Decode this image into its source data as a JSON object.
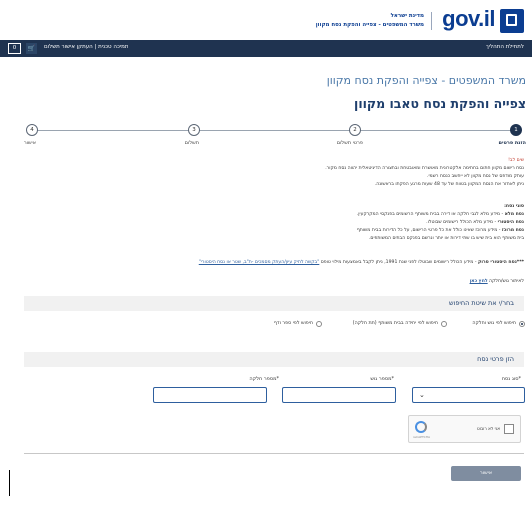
{
  "header": {
    "logo_text": "gov.il",
    "state_name": "מדינת ישראל",
    "ministry_line": "משרד המשפטים - צפייה והפקת נסח מקוון"
  },
  "topbar": {
    "back_link": "לתחילת התהליך",
    "help_link": "תמיכה טכנית | העתקן אישור תשלום",
    "cart_icon": "cart-icon",
    "cart_count": "0"
  },
  "page": {
    "subtitle": "משרד המשפטים - צפייה והפקת נסח מקוון",
    "title": "צפייה והפקת נסח טאבו מקוון"
  },
  "stepper": [
    {
      "number": "1",
      "label": "הזנת פרטים",
      "active": true
    },
    {
      "number": "2",
      "label": "פרטי תשלום",
      "active": false
    },
    {
      "number": "3",
      "label": "תשלום",
      "active": false
    },
    {
      "number": "4",
      "label": "אישור",
      "active": false
    }
  ],
  "info": {
    "attention": "שים לב!",
    "line1": "נסח רישום מקוון חתום בחתימה אלקטרונית מאושרת ומאובטחת ובתצורה הדיגיטאלית יהווה נסח מקור.",
    "line2": "עותק מודפס של נסח מקוון לא ייחשב כנסח רשמי.",
    "line3": "ניתן לאחזר את הנסח המקוון בטווח של עד 48 שעות מרגע הפקתו בראשונה.",
    "types_title": "סוגי נסח:",
    "type1_name": "נסח מלא",
    "type1_desc": " - מידע מלא לגבי חלקה או דירה בבית משותף הרשומים בפנקסי המקרקעין.",
    "type2_name": "נסח היסטורי",
    "type2_desc": " - מידע מלא הכולל רישומים שבוטלו.",
    "type3_name": "נסח מרוכז",
    "type3_desc": " - מידע מרוכז שאינו כולל את כל פרטי הרישום, על כל הדירות בבית משותף",
    "type3_cont": "בית משותף הוא בית שיש בו שתי דירות או יותר ונרשם בפנקס הבתים המשותפים.",
    "history_note_bold": "***נסח היסטורי סרוק",
    "history_note": " - מידע הכולל רישומים שבוטלו לפני שנת 1991, ניתן לקבל באמצעות מילוי טופס ",
    "history_link": "\"בקשה לתיק עיון/העתק מסמכים -ת\"ב, שטר או נסח היסטורי\"",
    "locate_text": "לאיתור גוש/חלקה ",
    "locate_link": "לחץ כאן"
  },
  "search": {
    "title": "בחר/י את שיטת החיפוש",
    "options": [
      {
        "label": "חיפוש לפי גוש וחלקה",
        "checked": true
      },
      {
        "label": "חיפוש לפי יחידה בבית משותף (תת חלקה)",
        "checked": false
      },
      {
        "label": "חיפוש לפי ספר ודף",
        "checked": false
      }
    ]
  },
  "details": {
    "title": "הזן פרטי נסח",
    "type_label": "*סוג נסח",
    "block_label": "*מספר גוש",
    "parcel_label": "*מספר חלקה",
    "type_value": "",
    "block_value": "",
    "parcel_value": ""
  },
  "captcha": {
    "label": "אני לא רובוט",
    "brand": "reCAPTCHA"
  },
  "actions": {
    "submit_label": "אישור"
  },
  "colors": {
    "navy": "#1f3350",
    "link_blue": "#2e5f9e",
    "button_gray": "#7f8da0",
    "alert_red": "#c0392b"
  }
}
